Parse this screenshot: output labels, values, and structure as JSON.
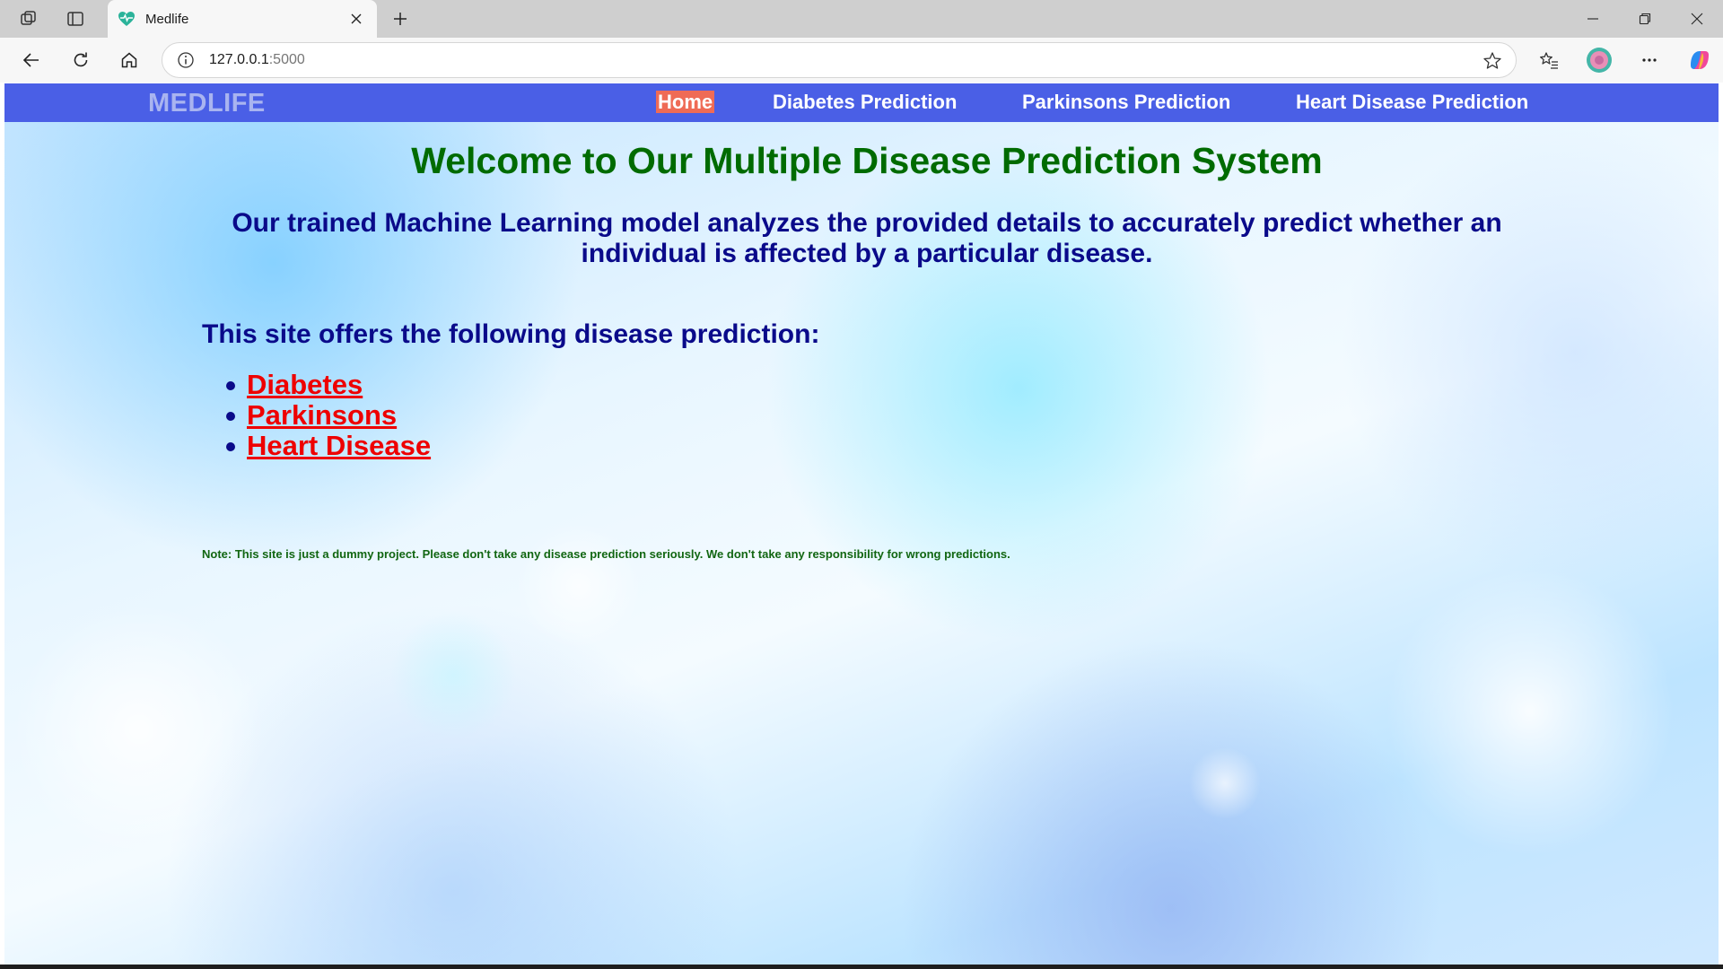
{
  "browser": {
    "tab_title": "Medlife",
    "url_host": "127.0.0.1",
    "url_port": ":5000"
  },
  "navbar": {
    "brand": "MEDLIFE",
    "links": [
      {
        "label": "Home",
        "active": true
      },
      {
        "label": "Diabetes Prediction",
        "active": false
      },
      {
        "label": "Parkinsons Prediction",
        "active": false
      },
      {
        "label": "Heart Disease Prediction",
        "active": false
      }
    ]
  },
  "main": {
    "title": "Welcome to Our Multiple Disease Prediction System",
    "subtitle": "Our trained Machine Learning model analyzes the provided details to accurately predict whether an individual is affected by a particular disease.",
    "offers_heading": "This site offers the following disease prediction:",
    "diseases": [
      "Diabetes",
      "Parkinsons",
      "Heart Disease"
    ],
    "note": "Note: This site is just a dummy project. Please don't take any disease prediction seriously. We don't take any responsibility for wrong predictions."
  },
  "colors": {
    "navbar": "#4a5fe6",
    "active_nav": "#ef6b56",
    "title_green": "#006b00",
    "text_navy": "#0a0a8a",
    "link_red": "#ee0000"
  },
  "icons": [
    "workspaces-icon",
    "tab-actions-icon",
    "heartbeat-favicon",
    "close-icon",
    "plus-icon",
    "minimize-icon",
    "restore-icon",
    "window-close-icon",
    "back-arrow-icon",
    "refresh-icon",
    "home-icon",
    "info-icon",
    "star-icon",
    "favorites-icon",
    "profile-avatar",
    "more-icon",
    "copilot-icon"
  ]
}
